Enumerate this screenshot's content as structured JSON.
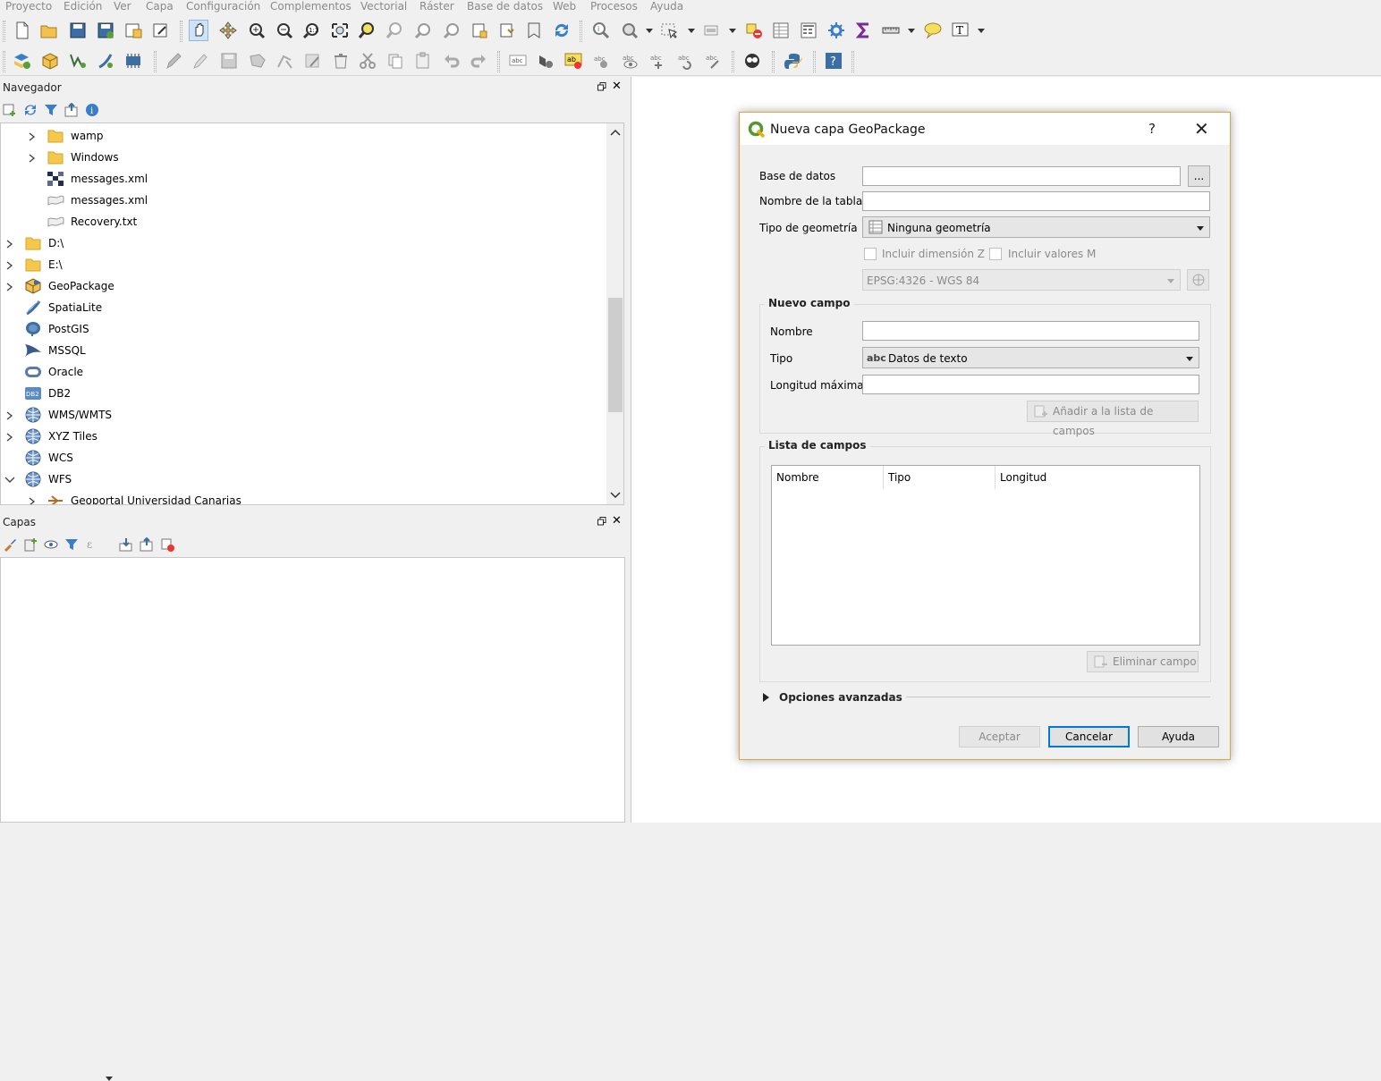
{
  "menubar": [
    "Proyecto",
    "Edición",
    "Ver",
    "Capa",
    "Configuración",
    "Complementos",
    "Vectorial",
    "Ráster",
    "Base de datos",
    "Web",
    "Procesos",
    "Ayuda"
  ],
  "browser_panel": {
    "title": "Navegador",
    "items": [
      {
        "label": "wamp",
        "icon": "folder-icon",
        "expandable": true
      },
      {
        "label": "Windows",
        "icon": "folder-icon",
        "expandable": true
      },
      {
        "label": "messages.xml",
        "icon": "raster-file-icon",
        "expandable": false
      },
      {
        "label": "messages.xml",
        "icon": "vector-file-icon",
        "expandable": false
      },
      {
        "label": "Recovery.txt",
        "icon": "vector-file-icon",
        "expandable": false
      },
      {
        "label": "D:\\",
        "icon": "folder-icon",
        "expandable": true
      },
      {
        "label": "E:\\",
        "icon": "folder-icon",
        "expandable": true
      },
      {
        "label": "GeoPackage",
        "icon": "geopackage-icon",
        "expandable": true
      },
      {
        "label": "SpatiaLite",
        "icon": "spatialite-icon",
        "expandable": false
      },
      {
        "label": "PostGIS",
        "icon": "postgis-icon",
        "expandable": false
      },
      {
        "label": "MSSQL",
        "icon": "mssql-icon",
        "expandable": false
      },
      {
        "label": "Oracle",
        "icon": "oracle-icon",
        "expandable": false
      },
      {
        "label": "DB2",
        "icon": "db2-icon",
        "expandable": false
      },
      {
        "label": "WMS/WMTS",
        "icon": "globe-icon",
        "expandable": true
      },
      {
        "label": "XYZ Tiles",
        "icon": "globe-icon",
        "expandable": true
      },
      {
        "label": "WCS",
        "icon": "globe-icon",
        "expandable": false
      },
      {
        "label": "WFS",
        "icon": "globe-icon",
        "expandable": true,
        "expanded": true
      },
      {
        "label": "Geoportal Universidad Canarias",
        "icon": "connection-icon",
        "expandable": true
      }
    ]
  },
  "layers_panel": {
    "title": "Capas"
  },
  "dialog": {
    "title": "Nueva capa GeoPackage",
    "help": "?",
    "close": "✕",
    "database_label": "Base de datos",
    "database_value": "",
    "browse_label": "...",
    "table_label": "Nombre de la tabla",
    "table_value": "",
    "geometry_label": "Tipo de geometría",
    "geometry_value": "Ninguna geometría",
    "z_label": "Incluir dimensión Z",
    "m_label": "Incluir valores M",
    "crs_value": "EPSG:4326 - WGS 84",
    "new_field": {
      "title": "Nuevo campo",
      "name_label": "Nombre",
      "name_value": "",
      "type_label": "Tipo",
      "type_prefix": "abc",
      "type_value": "Datos de texto",
      "maxlen_label": "Longitud máxima",
      "maxlen_value": "",
      "add_button": "Añadir a la lista de campos"
    },
    "field_list": {
      "title": "Lista de campos",
      "columns": [
        "Nombre",
        "Tipo",
        "Longitud"
      ],
      "rows": [],
      "remove_button": "Eliminar campo"
    },
    "advanced_label": "Opciones avanzadas",
    "buttons": {
      "ok": "Aceptar",
      "cancel": "Cancelar",
      "help": "Ayuda"
    }
  },
  "colors": {
    "accent": "#0078d7",
    "dialog_border": "#e8a33d",
    "qgis_green": "#589632"
  }
}
